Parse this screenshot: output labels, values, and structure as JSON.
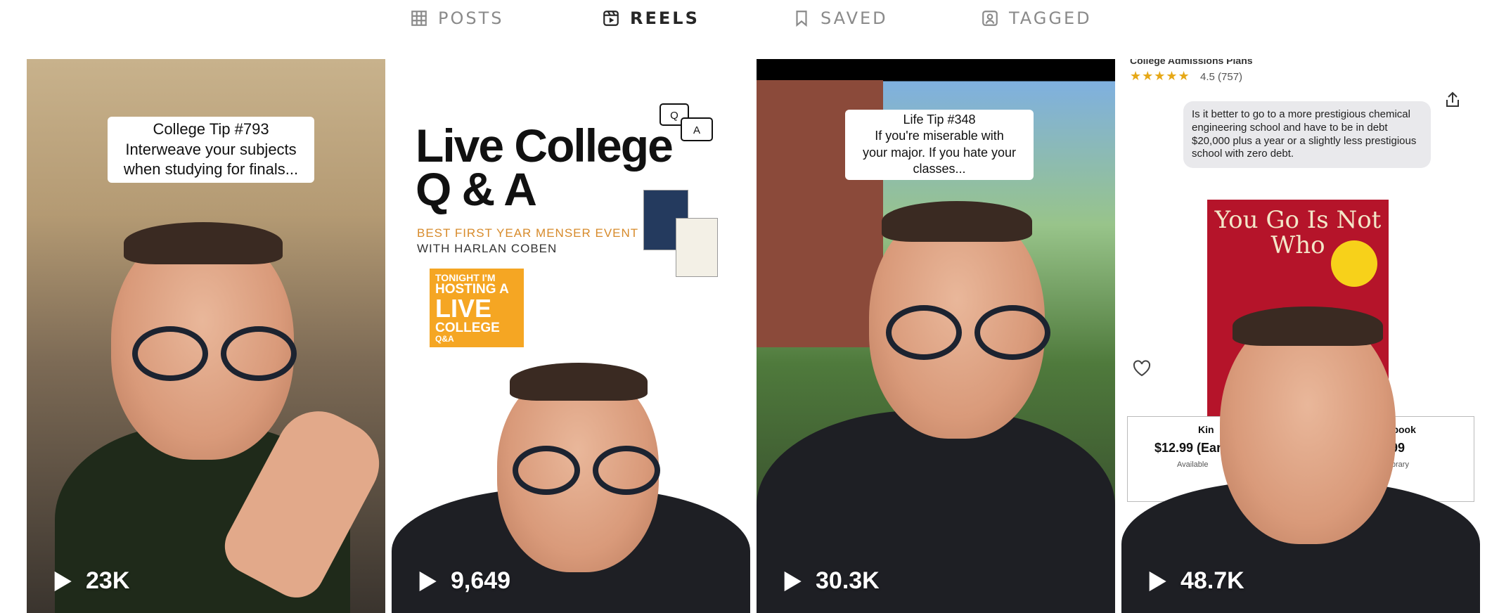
{
  "tabs": {
    "posts": "POSTS",
    "reels": "REELS",
    "saved": "SAVED",
    "tagged": "TAGGED",
    "active": "reels"
  },
  "reels": [
    {
      "caption_line1": "College Tip #793",
      "caption_line2": "Interweave your subjects",
      "caption_line3": "when studying for finals...",
      "views": "23K"
    },
    {
      "event_logo_line1": "",
      "event_logo_line2": "",
      "event_title_line1": "Live College",
      "event_title_line2": "Q & A",
      "event_sub1": "BEST FIRST YEAR MENSER EVENT",
      "event_sub2": "WITH HARLAN COBEN",
      "qa_q": "Q",
      "qa_a": "A",
      "orange_line1": "TONIGHT I'M",
      "orange_line2": "HOSTING A",
      "orange_line3": "LIVE",
      "orange_line4": "COLLEGE",
      "orange_line5": "Q&A",
      "views": "9,649"
    },
    {
      "caption_line1": "Life Tip #348",
      "caption_line2": "If you're miserable with",
      "caption_line3": "your major. If you hate your",
      "caption_line4": "classes...",
      "views": "30.3K"
    },
    {
      "product_title": "College Admissions Plans",
      "stars": "★★★★★",
      "rating": "4.5 (757)",
      "question": "Is it better to go to a more prestigious chemical engineering school and have to be in debt $20,000 plus a year or a slightly less prestigious school with zero debt.",
      "book_title": "You Go Is Not Who",
      "book_badge": "",
      "price_left_label": "Kin",
      "price_left": "$12.99 (Earn",
      "price_left_sub": "Available",
      "price_right_label": "lobook",
      "price_right": "99",
      "price_right_sub": "library",
      "views": "48.7K"
    }
  ],
  "colors": {
    "accent_orange": "#f5a623",
    "book_red": "#b5142a",
    "tab_active": "#262626",
    "tab_inactive": "#8a8a8a"
  }
}
